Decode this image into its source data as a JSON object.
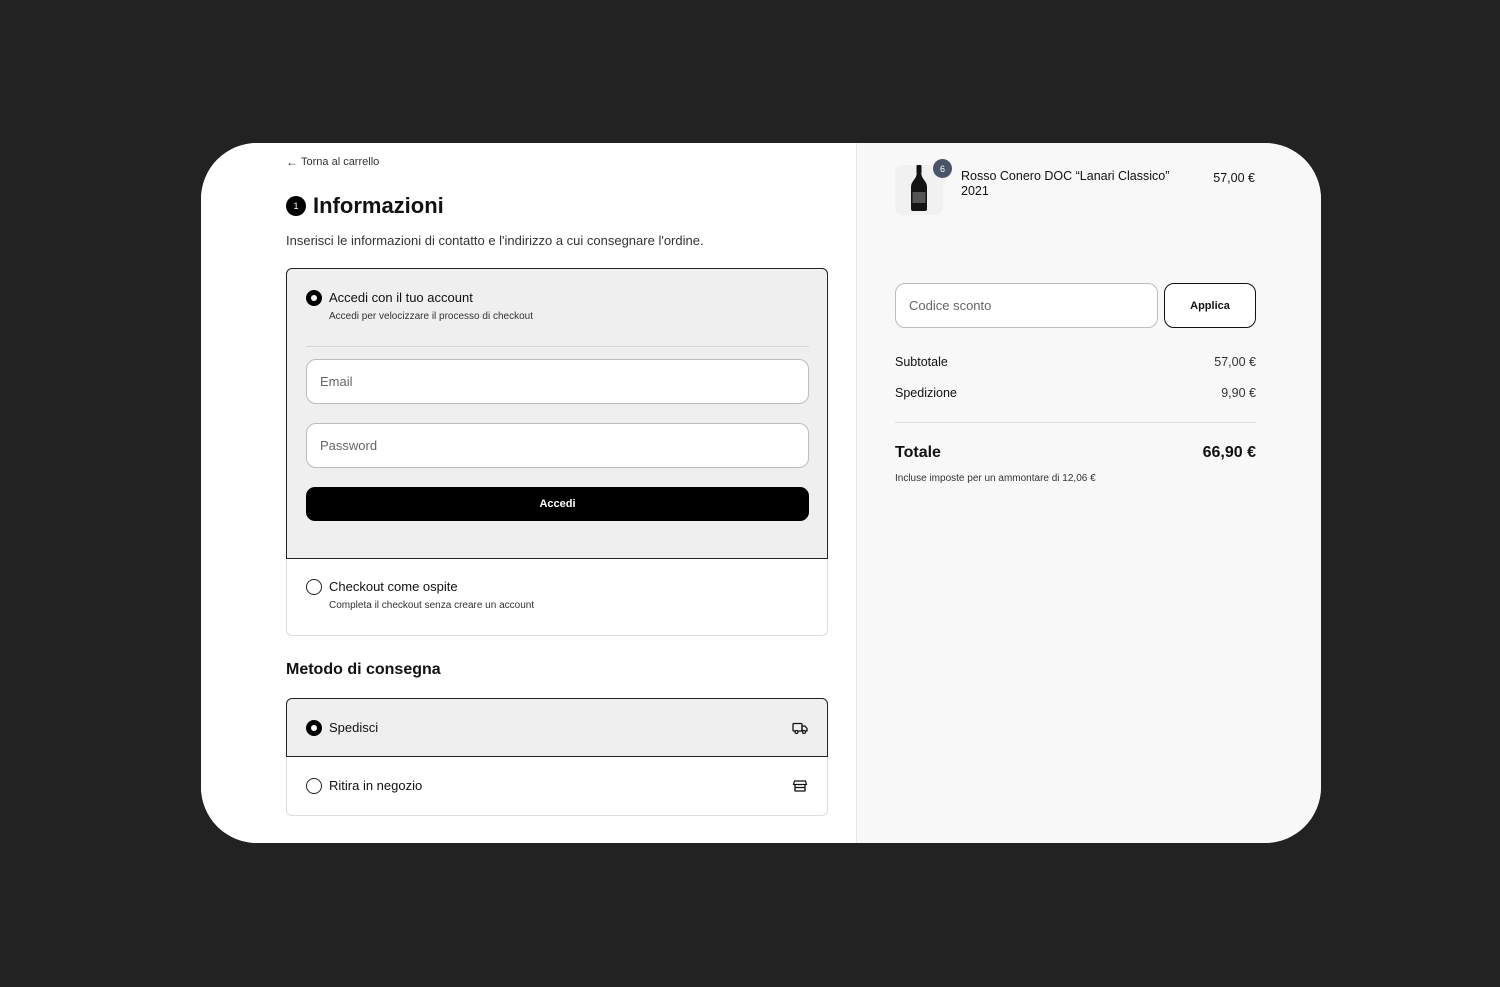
{
  "checkout": {
    "back_link": "Torna al carrello",
    "step_number": "1",
    "title": "Informazioni",
    "subtitle": "Inserisci le informazioni di contatto e l'indirizzo a cui consegnare l'ordine.",
    "login_option": {
      "title": "Accedi con il tuo account",
      "description": "Accedi per velocizzare il processo di checkout",
      "selected": true
    },
    "email_placeholder": "Email",
    "password_placeholder": "Password",
    "login_button": "Accedi",
    "guest_option": {
      "title": "Checkout come ospite",
      "description": "Completa il checkout senza creare un account",
      "selected": false
    },
    "delivery": {
      "title": "Metodo di consegna",
      "options": [
        {
          "label": "Spedisci",
          "icon": "truck-icon",
          "selected": true
        },
        {
          "label": "Ritira in negozio",
          "icon": "store-icon",
          "selected": false
        }
      ]
    }
  },
  "summary": {
    "product": {
      "name": "Rosso Conero DOC “Lanari Classico” 2021",
      "price": "57,00 €",
      "quantity": "6",
      "icon": "wine-bottle-icon"
    },
    "discount_placeholder": "Codice sconto",
    "apply_button": "Applica",
    "subtotal_label": "Subtotale",
    "subtotal_value": "57,00 €",
    "shipping_label": "Spedizione",
    "shipping_value": "9,90 €",
    "total_label": "Totale",
    "total_value": "66,90 €",
    "tax_note": "Incluse imposte per un ammontare di  12,06 €"
  },
  "colors": {
    "page_background": "#222222",
    "accent": "#000000",
    "badge": "#4a5468",
    "selected_background": "#efefef"
  }
}
